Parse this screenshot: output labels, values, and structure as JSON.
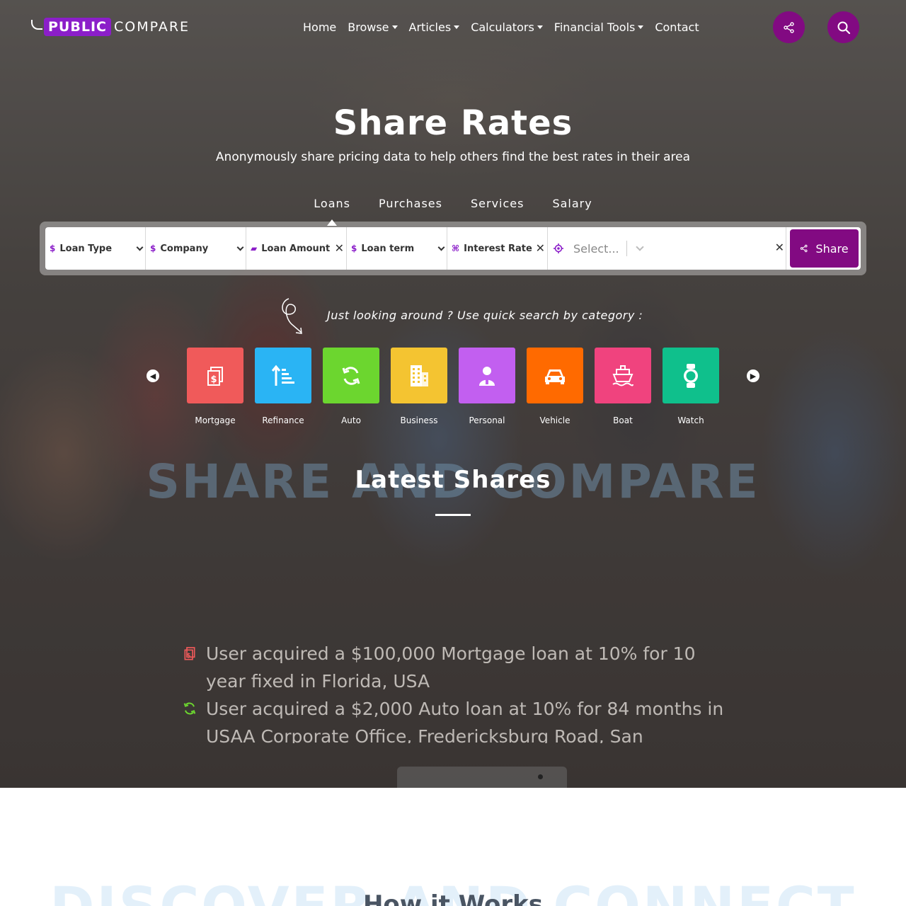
{
  "brand": {
    "badge": "PUBLIC",
    "text": "COMPARE"
  },
  "nav": [
    {
      "label": "Home",
      "dropdown": false
    },
    {
      "label": "Browse",
      "dropdown": true
    },
    {
      "label": "Articles",
      "dropdown": true
    },
    {
      "label": "Calculators",
      "dropdown": true
    },
    {
      "label": "Financial Tools",
      "dropdown": true
    },
    {
      "label": "Contact",
      "dropdown": false
    }
  ],
  "hero": {
    "title": "Share Rates",
    "subtitle": "Anonymously share pricing data to help others find the best rates in their area"
  },
  "tabs": [
    "Loans",
    "Purchases",
    "Services",
    "Salary"
  ],
  "active_tab": "Loans",
  "search": {
    "loan_type": "Loan Type",
    "company": "Company",
    "loan_amount": "Loan Amount",
    "loan_term": "Loan term",
    "interest_rate": "Interest Rate",
    "location_placeholder": "Select...",
    "share_label": "Share"
  },
  "quick_search": "Just looking around ? Use quick search by category :",
  "categories": [
    {
      "label": "Mortgage",
      "color": "#f05a5a",
      "icon": "mortgage-icon"
    },
    {
      "label": "Refinance",
      "color": "#2ab4f4",
      "icon": "refinance-icon"
    },
    {
      "label": "Auto",
      "color": "#6cd62f",
      "icon": "auto-icon"
    },
    {
      "label": "Business",
      "color": "#f4c431",
      "icon": "business-icon"
    },
    {
      "label": "Personal",
      "color": "#c25ff0",
      "icon": "personal-icon"
    },
    {
      "label": "Vehicle",
      "color": "#ff6a00",
      "icon": "vehicle-icon"
    },
    {
      "label": "Boat",
      "color": "#f0437e",
      "icon": "boat-icon"
    },
    {
      "label": "Watch",
      "color": "#0fc08c",
      "icon": "watch-icon"
    }
  ],
  "latest": {
    "watermark": "SHARE AND COMPARE",
    "title": "Latest Shares",
    "items": [
      {
        "text": "User acquired a $100,000 Mortgage loan at 10% for 10 year fixed in Florida, USA",
        "icon": "mortgage-icon",
        "color": "#f05a5a"
      },
      {
        "text": "User acquired a $2,000 Auto loan at 10% for 84 months in USAA Corporate Office, Fredericksburg Road, San",
        "icon": "auto-icon",
        "color": "#6cd62f"
      }
    ]
  },
  "how": {
    "watermark": "DISCOVER AND CONNECT",
    "title": "How it Works"
  }
}
